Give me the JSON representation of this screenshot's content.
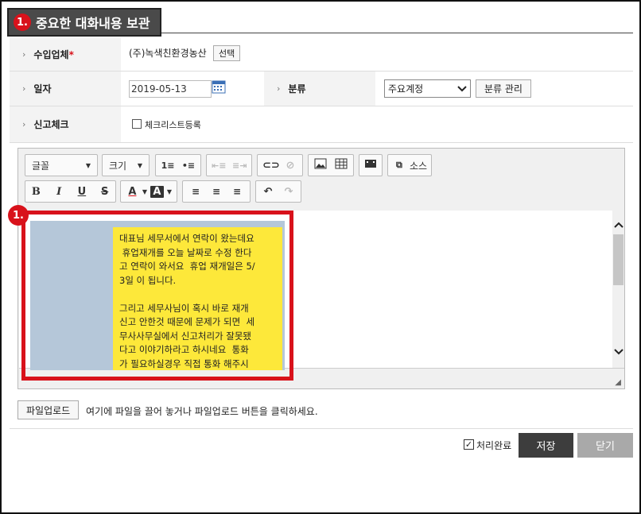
{
  "header": {
    "step_num": "1.",
    "title": "중요한 대화내용 보관"
  },
  "form": {
    "company_label": "수입업체",
    "company_required": "*",
    "company_value": "(주)녹색친환경농산",
    "select_button": "선택",
    "date_label": "일자",
    "date_value": "2019-05-13",
    "category_label": "분류",
    "category_selected": "주요계정",
    "category_manage_button": "분류 관리",
    "report_label": "신고체크",
    "checklist_label": "체크리스트등록"
  },
  "editor": {
    "font_label": "글꼴",
    "size_label": "크기",
    "source_label": "소스",
    "annotation_num": "1.",
    "chat_text": "대표님 세무서에서 연락이 왔는데요\n 휴업재개를 오늘 날짜로 수정 한다\n고 연락이 와서요  휴업 재개일은 5/\n3일 이 됩니다.\n\n그리고 세무사님이 혹시 바로 재개\n신고 안한것 때문에 문제가 되면  세\n무사사무실에서 신고처리가 잘못됐\n다고 이야기하라고 하시네요  통화\n가 필요하실경우 직접 통화 해주시"
  },
  "upload": {
    "button": "파일업로드",
    "hint": "여기에 파일을 끌어 놓거나 파일업로드 버튼을 클릭하세요."
  },
  "footer": {
    "done_label": "처리완료",
    "save_button": "저장",
    "close_button": "닫기"
  },
  "colors": {
    "accent_red": "#d8121b",
    "save_bg": "#3d3d3d",
    "close_bg": "#a9a9a9",
    "bubble": "#fde83a"
  }
}
